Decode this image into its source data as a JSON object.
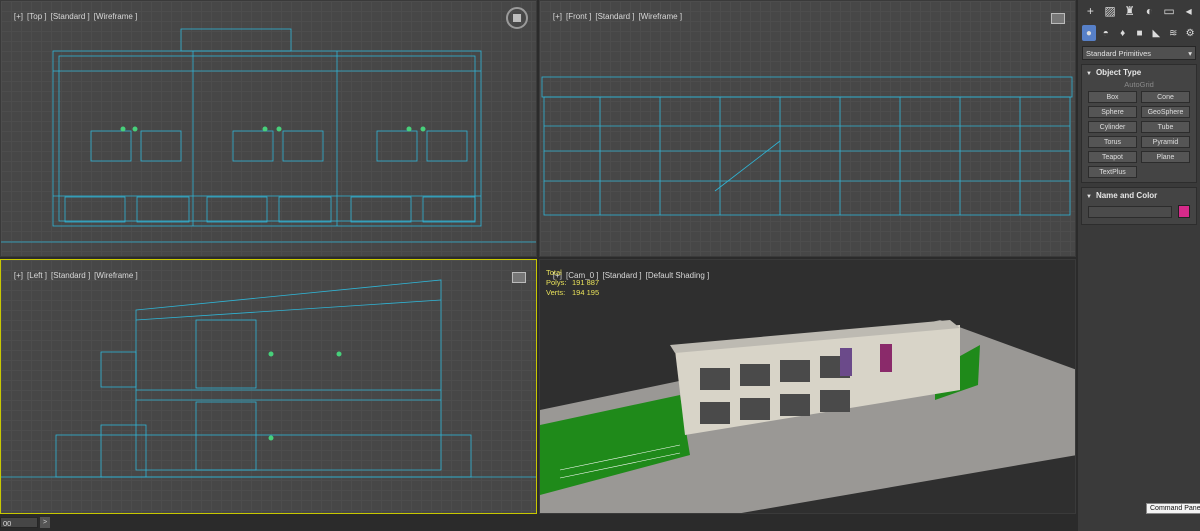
{
  "viewports": {
    "top": {
      "labels": [
        "[+]",
        "[Top ]",
        "[Standard ]",
        "[Wireframe ]"
      ]
    },
    "front": {
      "labels": [
        "[+]",
        "[Front ]",
        "[Standard ]",
        "[Wireframe ]"
      ]
    },
    "left": {
      "labels": [
        "[+]",
        "[Left ]",
        "[Standard ]",
        "[Wireframe ]"
      ]
    },
    "camera": {
      "labels": [
        "[+]",
        "[Cam_0 ]",
        "[Standard ]",
        "[Default Shading ]"
      ],
      "stats": {
        "title": "Total",
        "polys_label": "Polys:",
        "polys": "191 887",
        "verts_label": "Verts:",
        "verts": "194 195"
      }
    }
  },
  "command_panel": {
    "tab_icons": [
      "create-icon",
      "modify-icon",
      "hierarchy-icon",
      "motion-icon",
      "display-icon",
      "utilities-icon"
    ],
    "category_icons": [
      "geometry-icon",
      "shapes-icon",
      "lights-icon",
      "cameras-icon",
      "helpers-icon",
      "spacewarps-icon",
      "systems-icon"
    ],
    "category_dropdown": "Standard Primitives",
    "object_type": {
      "title": "Object Type",
      "autogrid": "AutoGrid",
      "buttons": [
        "Box",
        "Cone",
        "Sphere",
        "GeoSphere",
        "Cylinder",
        "Tube",
        "Torus",
        "Pyramid",
        "Teapot",
        "Plane",
        "TextPlus"
      ]
    },
    "name_and_color": {
      "title": "Name and Color",
      "name_value": "",
      "color": "#d62a8a"
    }
  },
  "tooltip": "Command Panel",
  "timeline": {
    "frame": "00"
  },
  "colors": {
    "wire": "#2fb5d6",
    "accent": "#5780c8",
    "active_border": "#c8c800"
  }
}
